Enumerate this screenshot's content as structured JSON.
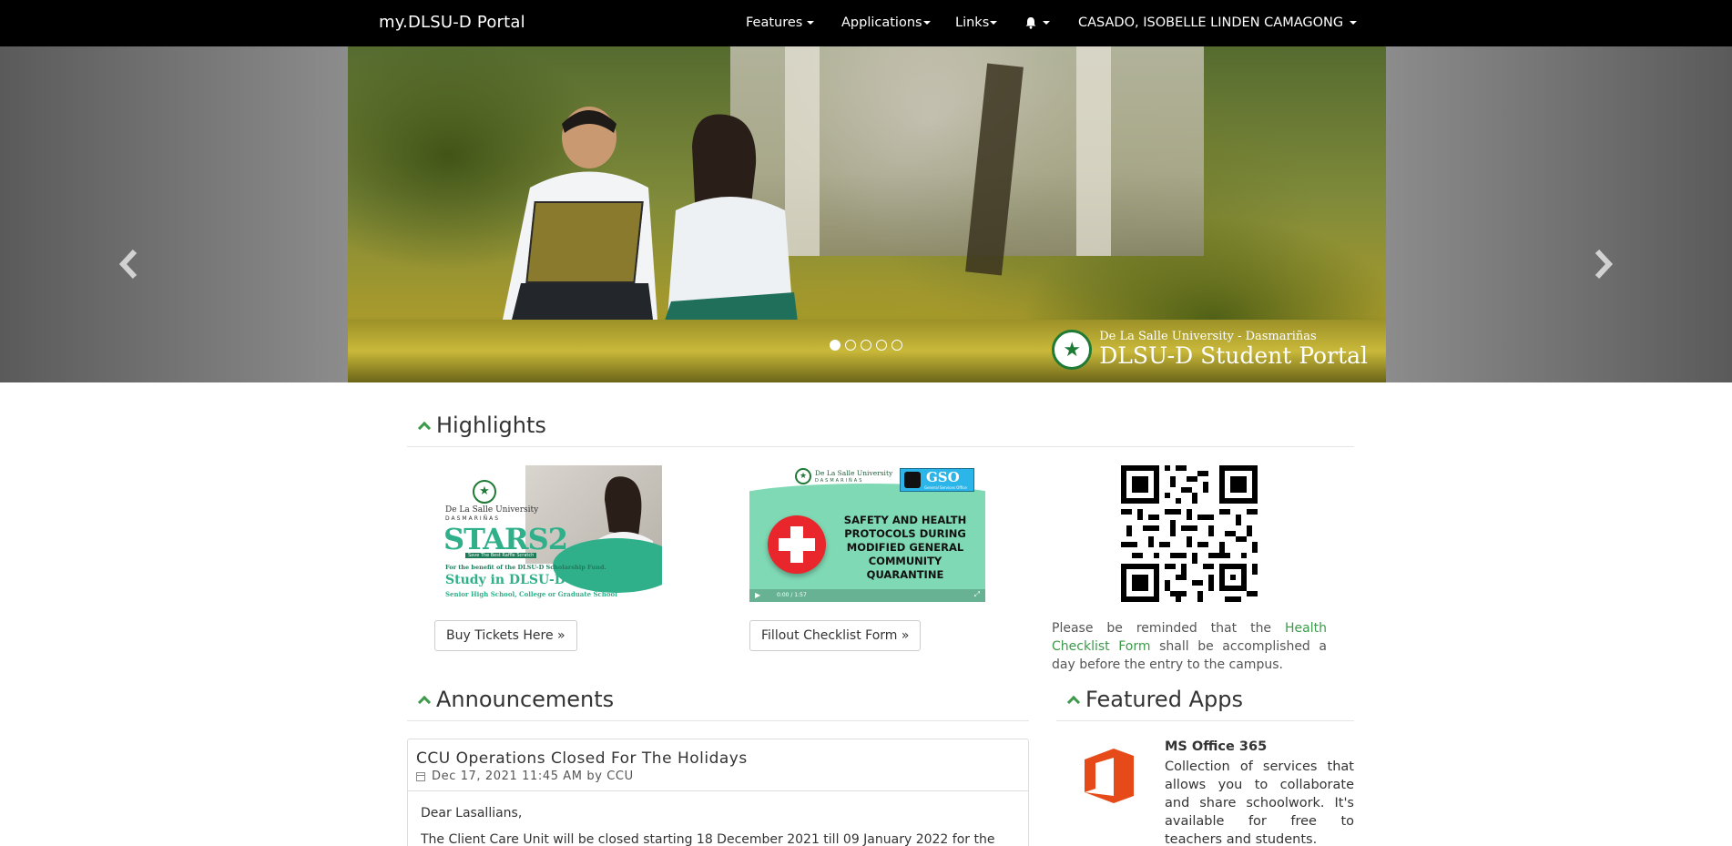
{
  "navbar": {
    "brand": "my.DLSU-D Portal",
    "features": "Features",
    "applications": "Applications",
    "links": "Links",
    "user": "CASADO, ISOBELLE LINDEN CAMAGONG"
  },
  "carousel": {
    "logo_small": "De La Salle University - Dasmariñas",
    "logo_big": "DLSU-D Student Portal",
    "slide_count": 5,
    "active_slide": 1
  },
  "highlights": {
    "title": "Highlights",
    "card1": {
      "seal_line1": "De La Salle University",
      "seal_line2": "DASMARIÑAS",
      "stars": "STARS2",
      "sub": "Save The Best Raffle Scratch",
      "benefit": "For the benefit of the DLSU-D Scholarship Fund.",
      "headline": "Study in DLSU-D for free!",
      "levels": "Senior High School, College or Graduate School",
      "button": "Buy Tickets Here »"
    },
    "card2": {
      "univ": "De La Salle University",
      "univ2": "DASMARIÑAS",
      "gso": "GSO",
      "gso_sub": "General Services Office",
      "headline": "SAFETY AND HEALTH PROTOCOLS DURING MODIFIED GENERAL COMMUNITY QUARANTINE",
      "video_time": "0:00 / 1:57",
      "button": "Fillout Checklist Form »"
    },
    "notice": {
      "before": "Please be reminded that the ",
      "link": "Health Checklist Form",
      "after": " shall be accomplished a day before the entry to the campus."
    }
  },
  "announcements": {
    "title": "Announcements",
    "items": [
      {
        "title": "CCU Operations Closed For The Holidays",
        "meta": "Dec 17, 2021 11:45 AM by CCU",
        "greeting": "Dear Lasallians,",
        "body": "The Client Care Unit will be closed starting 18 December 2021 till 09 January 2022 for the"
      }
    ]
  },
  "featured_apps": {
    "title": "Featured Apps",
    "apps": [
      {
        "name": "MS Office 365",
        "description": "Collection of services that allows you to collaborate and share schoolwork. It's available for free to teachers and students."
      }
    ]
  },
  "colors": {
    "accent": "#3c9a4a",
    "navbar": "#000000",
    "office": "#e64a19"
  }
}
